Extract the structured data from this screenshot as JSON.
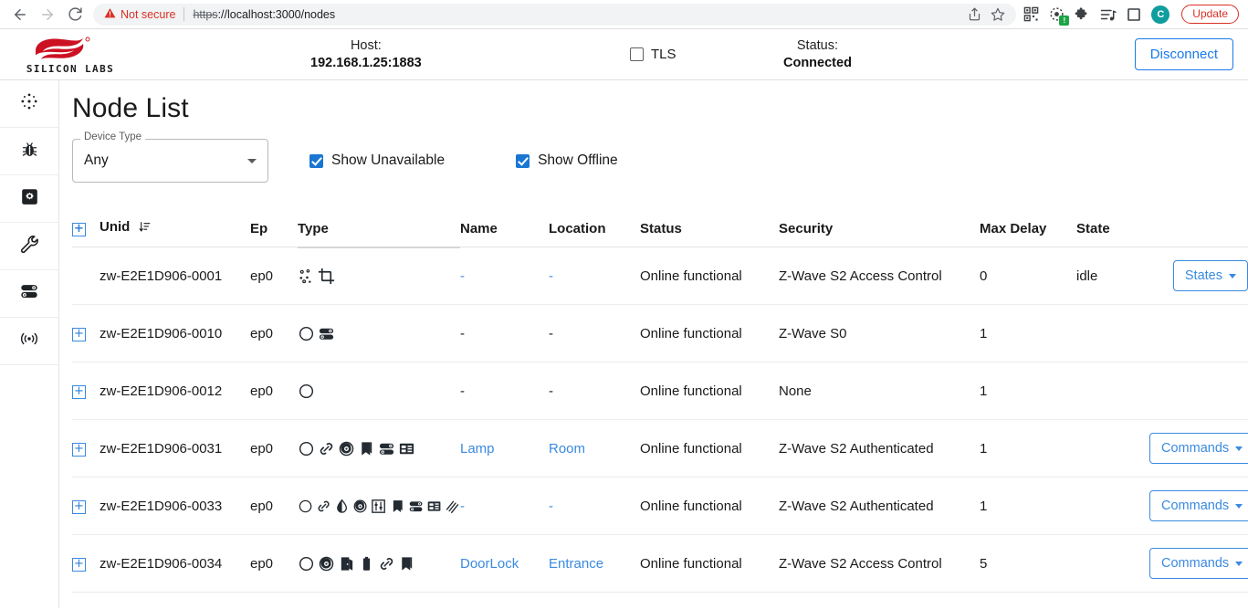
{
  "browser": {
    "back_icon": "back-arrow-icon",
    "forward_icon": "forward-arrow-icon",
    "reload_icon": "reload-icon",
    "security_warning": "Not secure",
    "url_scheme": "https",
    "url_rest": "://localhost:3000/nodes",
    "share_icon": "share-icon",
    "bookmark_icon": "star-icon",
    "toolbar_icons": [
      "qr-code-icon",
      "extension-loading-icon",
      "puzzle-extensions-icon",
      "media-list-icon",
      "side-panel-icon"
    ],
    "extension_badge": "!",
    "profile_initial": "C",
    "update_label": "Update"
  },
  "header": {
    "logo_text": "SILICON LABS",
    "host_label": "Host:",
    "host_value": "192.168.1.25:1883",
    "tls_label": "TLS",
    "tls_checked": false,
    "status_label": "Status:",
    "status_value": "Connected",
    "disconnect_label": "Disconnect"
  },
  "sidebar": {
    "items": [
      {
        "icon": "nodes-network-icon",
        "name": "sidebar-item-nodes"
      },
      {
        "icon": "bug-icon",
        "name": "sidebar-item-debug"
      },
      {
        "icon": "gear-square-icon",
        "name": "sidebar-item-settings"
      },
      {
        "icon": "wrench-icon",
        "name": "sidebar-item-tools"
      },
      {
        "icon": "server-stack-icon",
        "name": "sidebar-item-smartstart"
      },
      {
        "icon": "broadcast-antenna-icon",
        "name": "sidebar-item-rf-telemetry"
      }
    ]
  },
  "main": {
    "page_title": "Node List",
    "device_type_legend": "Device Type",
    "device_type_value": "Any",
    "show_unavailable_label": "Show Unavailable",
    "show_unavailable_checked": true,
    "show_offline_label": "Show Offline",
    "show_offline_checked": true
  },
  "table": {
    "expand_all_icon": "plus-box-icon",
    "sort_icon": "sort-descending-icon",
    "columns": [
      "Unid",
      "Ep",
      "Type",
      "Name",
      "Location",
      "Status",
      "Security",
      "Max Delay",
      "State"
    ],
    "rows": [
      {
        "expandable": false,
        "unid": "zw-E2E1D906-0001",
        "ep": "ep0",
        "type_icons": [
          "network-dots-icon",
          "crop-icon"
        ],
        "name": "-",
        "name_link": true,
        "location": "-",
        "location_link": true,
        "status": "Online functional",
        "security": "Z-Wave S2 Access Control",
        "max_delay": "0",
        "state": "idle",
        "action": "States"
      },
      {
        "expandable": true,
        "unid": "zw-E2E1D906-0010",
        "ep": "ep0",
        "type_icons": [
          "circle-icon",
          "server-stack-icon"
        ],
        "name": "-",
        "name_link": false,
        "location": "-",
        "location_link": false,
        "status": "Online functional",
        "security": "Z-Wave S0",
        "max_delay": "1",
        "state": "",
        "action": ""
      },
      {
        "expandable": true,
        "unid": "zw-E2E1D906-0012",
        "ep": "ep0",
        "type_icons": [
          "circle-icon"
        ],
        "name": "-",
        "name_link": false,
        "location": "-",
        "location_link": false,
        "status": "Online functional",
        "security": "None",
        "max_delay": "1",
        "state": "",
        "action": ""
      },
      {
        "expandable": true,
        "unid": "zw-E2E1D906-0031",
        "ep": "ep0",
        "type_icons": [
          "circle-icon",
          "link-icon",
          "target-icon",
          "bookmark-icon",
          "server-stack-icon",
          "panel-icon"
        ],
        "name": "Lamp",
        "name_link": true,
        "location": "Room",
        "location_link": true,
        "status": "Online functional",
        "security": "Z-Wave S2 Authenticated",
        "max_delay": "1",
        "state": "",
        "action": "Commands"
      },
      {
        "expandable": true,
        "unid": "zw-E2E1D906-0033",
        "ep": "ep0",
        "type_icons": [
          "circle-icon",
          "link-icon",
          "droplet-icon",
          "target-icon",
          "sliders-icon",
          "bookmark-icon",
          "server-stack-icon",
          "panel-icon",
          "waves-icon"
        ],
        "name": "-",
        "name_link": true,
        "location": "-",
        "location_link": true,
        "status": "Online functional",
        "security": "Z-Wave S2 Authenticated",
        "max_delay": "1",
        "state": "",
        "action": "Commands"
      },
      {
        "expandable": true,
        "unid": "zw-E2E1D906-0034",
        "ep": "ep0",
        "type_icons": [
          "circle-icon",
          "target-icon",
          "door-icon",
          "battery-icon",
          "link-icon",
          "bookmark-icon"
        ],
        "name": "DoorLock",
        "name_link": true,
        "location": "Entrance",
        "location_link": true,
        "status": "Online functional",
        "security": "Z-Wave S2 Access Control",
        "max_delay": "5",
        "state": "",
        "action": "Commands"
      }
    ]
  },
  "colors": {
    "accent_blue": "#3a8ae0",
    "brand_red": "#cc1122",
    "danger_red": "#d93025",
    "checkbox_blue": "#1976d2"
  }
}
